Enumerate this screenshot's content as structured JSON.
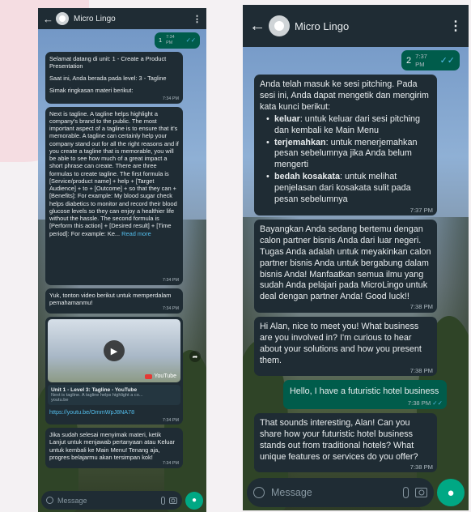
{
  "left_phone": {
    "contact_name": "Micro Lingo",
    "back_icon": "←",
    "menu_icon": "⋮",
    "messages": {
      "m1": {
        "text": "1",
        "time": "7:34 PM",
        "ticks": "✓✓"
      },
      "m2": {
        "line1": "Selamat datang di unit: 1 - Create a Product Presentation",
        "line2": "Saat ini, Anda berada pada level: 3 - Tagline",
        "line3": "Simak ringkasan materi berikut:",
        "time": "7:34 PM"
      },
      "m3": {
        "text": "Next is tagline. A tagline helps highlight a company's brand to the public. The most important aspect of a tagline is to ensure that it's memorable. A tagline can certainly help your company stand out for all the right reasons and if you create a tagline that is memorable, you will be able to see how much of a great impact a short phrase can create. There are three formulas to create tagline. The first formula is [Service/product name] + help + [Target Audience] + to + [Outcome] + so that they can + [Benefits]: For example: My blood sugar check helps diabetics to monitor and record their blood glucose levels so they can enjoy a healthier life without the hassle. The second formula is [Perform this action] + [Desired result] + [Time period]: For example: Ke...",
        "read_more": "Read more",
        "time": "7:34 PM"
      },
      "m4": {
        "text": "Yuk, tonton video berikut untuk memperdalam pemahamanmu!",
        "time": "7:34 PM"
      },
      "m5": {
        "youtube_label": "YouTube",
        "video_title": "Unit 1 - Level 3: Tagline - YouTube",
        "video_desc": "Next is tagline. A tagline helps highlight a co...",
        "domain": "youtu.be",
        "link": "https://youtu.be/OmmWpJ8NA78",
        "time": "7:34 PM"
      },
      "m6": {
        "text": "Jika sudah selesai menyimak materi, ketik Lanjut untuk menjawab pertanyaan atau Keluar untuk kembali ke Main Menu! Tenang aja, progres belajarmu akan tersimpan kok!",
        "time": "7:34 PM"
      }
    },
    "input_placeholder": "Message"
  },
  "right_phone": {
    "contact_name": "Micro Lingo",
    "back_icon": "←",
    "menu_icon": "⋮",
    "messages": {
      "r1": {
        "text": "2",
        "time": "7:37 PM",
        "ticks": "✓✓"
      },
      "r2": {
        "intro": "Anda telah masuk ke sesi pitching. Pada sesi ini, Anda dapat mengetik dan mengirim kata kunci berikut:",
        "bullets": [
          {
            "kw": "keluar",
            "desc": ": untuk keluar dari sesi pitching dan kembali ke Main Menu"
          },
          {
            "kw": "terjemahkan",
            "desc": ": untuk menerjemahkan pesan sebelumnya jika Anda belum mengerti"
          },
          {
            "kw": "bedah kosakata",
            "desc": ": untuk melihat penjelasan dari kosakata sulit pada pesan sebelumnya"
          }
        ],
        "time": "7:37 PM"
      },
      "r3": {
        "text": "Bayangkan Anda sedang bertemu dengan calon partner bisnis Anda dari luar negeri. Tugas Anda adalah untuk meyakinkan calon partner bisnis Anda untuk bergabung dalam bisnis Anda! Manfaatkan semua ilmu yang sudah Anda pelajari pada MicroLingo untuk deal dengan partner Anda! Good luck!!",
        "time": "7:38 PM"
      },
      "r4": {
        "text": "Hi Alan, nice to meet you! What business are you involved in? I'm curious to hear about your solutions and how you present them.",
        "time": "7:38 PM"
      },
      "r5": {
        "text": "Hello, I have a futuristic hotel business",
        "time": "7:38 PM",
        "ticks": "✓✓"
      },
      "r6": {
        "text": "That sounds interesting, Alan! Can you share how your futuristic hotel business stands out from traditional hotels? What unique features or services do you offer?",
        "time": "7:38 PM"
      }
    },
    "input_placeholder": "Message"
  },
  "colors": {
    "header": "#1f2c34",
    "incoming": "#1f2c34",
    "outgoing": "#005c4b",
    "accent": "#00a884",
    "link": "#53bdeb"
  }
}
